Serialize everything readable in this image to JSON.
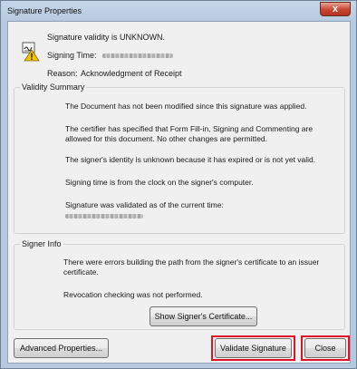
{
  "window": {
    "title": "Signature Properties",
    "close_glyph": "x"
  },
  "header": {
    "validity": "Signature validity is UNKNOWN.",
    "signing_time_label": "Signing Time:",
    "reason_label": "Reason:",
    "reason_value": "Acknowledgment of Receipt"
  },
  "validity_summary": {
    "label": "Validity Summary",
    "items": [
      "The Document has not been modified since this signature was applied.",
      "The certifier has specified that Form Fill-in, Signing and Commenting are",
      "allowed for this document. No other changes are permitted.",
      "The signer's identity is unknown because it has expired or is not yet valid.",
      "Signing time is from the clock on the signer's computer.",
      "Signature was validated as of the current time:"
    ]
  },
  "signer_info": {
    "label": "Signer Info",
    "error_line1": "There were errors building the path from the signer's certificate to an issuer",
    "error_line2": "certificate.",
    "revocation": "Revocation checking was not performed.",
    "show_cert_button": "Show Signer's Certificate..."
  },
  "footer": {
    "advanced_button": "Advanced Properties...",
    "validate_button": "Validate Signature",
    "close_button": "Close"
  },
  "colors": {
    "highlight": "#e0132b",
    "warning": "#f2c200"
  },
  "icons": {
    "signature": "signature-warning-icon",
    "close": "close-icon"
  }
}
